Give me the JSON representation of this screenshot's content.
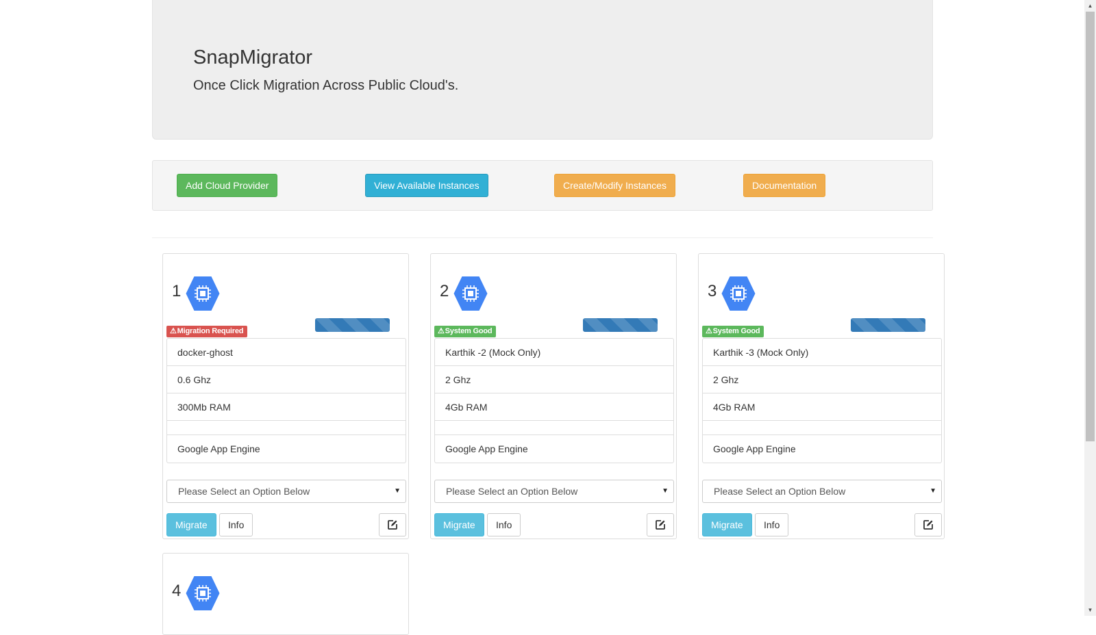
{
  "header": {
    "title": "SnapMigrator",
    "subtitle": "Once Click Migration Across Public Cloud's."
  },
  "toolbar": {
    "add_cloud_provider": "Add Cloud Provider",
    "view_instances": "View Available Instances",
    "create_modify": "Create/Modify Instances",
    "documentation": "Documentation"
  },
  "colors": {
    "success": "#5cb85c",
    "info": "#5bc0de",
    "warning": "#f0ad4e",
    "danger": "#d9534f",
    "primary": "#337ab7",
    "compute_icon": "#4285f4"
  },
  "instances": [
    {
      "number": "1",
      "icon": "compute-engine-icon",
      "status": "Migration Required",
      "status_type": "danger",
      "progress_percent": 100,
      "name": "docker-ghost",
      "cpu": "0.6 Ghz",
      "ram": "300Mb RAM",
      "extra": "",
      "provider": "Google App Engine",
      "select_value": "Please Select an Option Below",
      "migrate_label": "Migrate",
      "info_label": "Info"
    },
    {
      "number": "2",
      "icon": "compute-engine-icon",
      "status": "System Good",
      "status_type": "success",
      "progress_percent": 100,
      "name": "Karthik -2 (Mock Only)",
      "cpu": "2 Ghz",
      "ram": "4Gb RAM",
      "extra": "",
      "provider": "Google App Engine",
      "select_value": "Please Select an Option Below",
      "migrate_label": "Migrate",
      "info_label": "Info"
    },
    {
      "number": "3",
      "icon": "compute-engine-icon",
      "status": "System Good",
      "status_type": "success",
      "progress_percent": 100,
      "name": "Karthik -3 (Mock Only)",
      "cpu": "2 Ghz",
      "ram": "4Gb RAM",
      "extra": "",
      "provider": "Google App Engine",
      "select_value": "Please Select an Option Below",
      "migrate_label": "Migrate",
      "info_label": "Info"
    },
    {
      "number": "4",
      "icon": "compute-engine-icon"
    }
  ]
}
